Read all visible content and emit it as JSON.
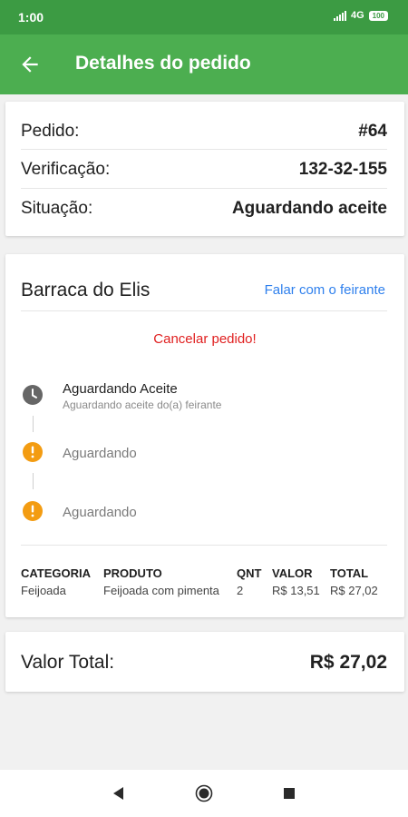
{
  "status_bar": {
    "time": "1:00",
    "network": "4G",
    "battery": "100"
  },
  "app_bar": {
    "title": "Detalhes do pedido",
    "back_icon": "arrow-left-icon"
  },
  "order_info": {
    "rows": [
      {
        "label": "Pedido:",
        "value": "#64"
      },
      {
        "label": "Verificação:",
        "value": "132-32-155"
      },
      {
        "label": "Situação:",
        "value": "Aguardando aceite"
      }
    ]
  },
  "vendor_card": {
    "vendor_name": "Barraca do Elis",
    "chat_link": "Falar com o feirante",
    "cancel_label": "Cancelar pedido!",
    "steps": [
      {
        "icon": "clock-icon",
        "title": "Aguardando Aceite",
        "subtitle": "Aguardando aceite do(a) feirante",
        "color": "#666666"
      },
      {
        "icon": "alert-icon",
        "title": "Aguardando",
        "subtitle": "",
        "color": "#f39c12"
      },
      {
        "icon": "alert-icon",
        "title": "Aguardando",
        "subtitle": "",
        "color": "#f39c12"
      }
    ],
    "table": {
      "headers": {
        "category": "CATEGORIA",
        "product": "PRODUTO",
        "qty": "QNT",
        "value": "VALOR",
        "total": "TOTAL"
      },
      "rows": [
        {
          "category": "Feijoada",
          "product": "Feijoada com pimenta",
          "qty": "2",
          "value": "R$ 13,51",
          "total": "R$ 27,02"
        }
      ]
    }
  },
  "total_card": {
    "label": "Valor Total:",
    "value": "R$ 27,02"
  },
  "colors": {
    "status_bar": "#3c9b43",
    "app_bar": "#4cae50",
    "link": "#2f80ed",
    "danger": "#e02020",
    "warning": "#f39c12"
  }
}
